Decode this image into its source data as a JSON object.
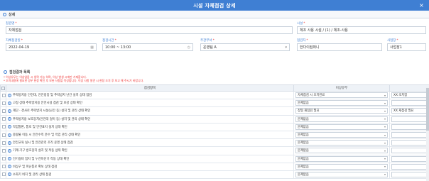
{
  "titlebar": {
    "title": "시설 자체점검 상세",
    "close": "×"
  },
  "section": {
    "title": "상세"
  },
  "form": {
    "inspection_name": {
      "label": "점검명",
      "value": "자체점검"
    },
    "facility": {
      "label": "시설",
      "value": "체조 사용 시설 / (1) / 체조-사용"
    },
    "inspection_date": {
      "label": "자체점검일",
      "value": "2022-04-19"
    },
    "inspection_time": {
      "label": "점검시간",
      "value": "10:00 ~ 13:00"
    },
    "department": {
      "label": "주관부서",
      "value": "운영팀 A"
    },
    "inspector": {
      "label": "점검자",
      "value": "한다이컴퍼니"
    },
    "business_site": {
      "label": "사업장",
      "value": "사업장1"
    }
  },
  "notice": {
    "title": "점검결과 목록",
    "lines": [
      "* 이상유무는 이상없음 시 생략 가능 하며, 이상 발생 시에만 기재합니다.",
      "* 조치내용에 필요한 경우 현장 확인 후 보완 사항을 작성합니다. 이상 사항 발견 시 현장 조치 후 보고 해 주시기 바랍니다."
    ]
  },
  "table": {
    "headers": [
      "점검항목",
      "이상유무",
      ""
    ],
    "rows": [
      {
        "item": "추락방지용 안전대, 안전방망 및 추락방지 난간 설치 상태 점검",
        "status": "자체점검 시 조치완료",
        "note": "XX 조치함"
      },
      {
        "item": "고정 상태 추락방지용 안전시설 점검 및 보강 상태 확인",
        "status": "문제없음",
        "note": ""
      },
      {
        "item": "계단 · 경사로 추락방지 시설(난간 등) 설치 및 관리 상태 확인",
        "status": "정밀 재점검 필요",
        "note": "XX 재점검 필요"
      },
      {
        "item": "추락방지용 보호장치(안전대 걸이 등) 설치 및 관리 상태 확인",
        "status": "문제없음",
        "note": ""
      },
      {
        "item": "작업발판, 통로 및 안전표지 설치 상태 확인",
        "status": "문제없음",
        "note": ""
      },
      {
        "item": "중량물 이동 시 안전수칙 준수 및 작업 관리 상태 확인",
        "status": "문제없음",
        "note": ""
      },
      {
        "item": "안전교육 실시 및 안전관리 조직 운영 상태 점검",
        "status": "문제없음",
        "note": ""
      },
      {
        "item": "기계·기구 방호장치 설치 및 작동 상태 확인",
        "status": "문제없음",
        "note": ""
      },
      {
        "item": "전기설비 접지 및 누전차단기 작동 상태 확인",
        "status": "문제없음",
        "note": ""
      },
      {
        "item": "비상구 및 피난통로 확보 상태 점검",
        "status": "문제없음",
        "note": ""
      },
      {
        "item": "소화기 비치 및 관리 상태 점검",
        "status": "문제없음",
        "note": ""
      }
    ]
  }
}
